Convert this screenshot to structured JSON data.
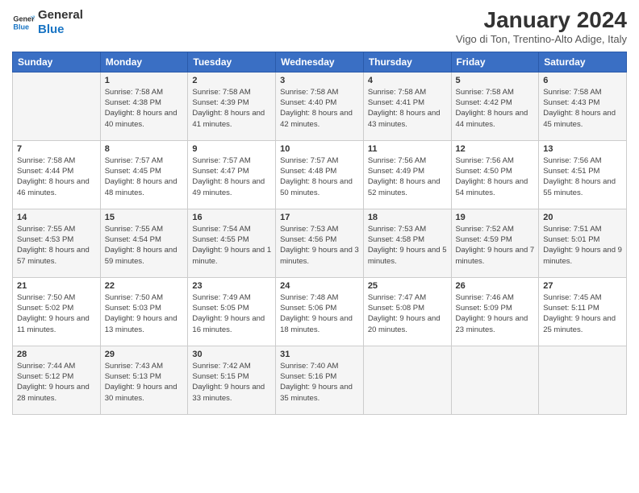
{
  "header": {
    "logo_line1": "General",
    "logo_line2": "Blue",
    "month": "January 2024",
    "location": "Vigo di Ton, Trentino-Alto Adige, Italy"
  },
  "days_of_week": [
    "Sunday",
    "Monday",
    "Tuesday",
    "Wednesday",
    "Thursday",
    "Friday",
    "Saturday"
  ],
  "weeks": [
    [
      {
        "day": "",
        "sunrise": "",
        "sunset": "",
        "daylight": ""
      },
      {
        "day": "1",
        "sunrise": "7:58 AM",
        "sunset": "4:38 PM",
        "daylight": "8 hours and 40 minutes."
      },
      {
        "day": "2",
        "sunrise": "7:58 AM",
        "sunset": "4:39 PM",
        "daylight": "8 hours and 41 minutes."
      },
      {
        "day": "3",
        "sunrise": "7:58 AM",
        "sunset": "4:40 PM",
        "daylight": "8 hours and 42 minutes."
      },
      {
        "day": "4",
        "sunrise": "7:58 AM",
        "sunset": "4:41 PM",
        "daylight": "8 hours and 43 minutes."
      },
      {
        "day": "5",
        "sunrise": "7:58 AM",
        "sunset": "4:42 PM",
        "daylight": "8 hours and 44 minutes."
      },
      {
        "day": "6",
        "sunrise": "7:58 AM",
        "sunset": "4:43 PM",
        "daylight": "8 hours and 45 minutes."
      }
    ],
    [
      {
        "day": "7",
        "sunrise": "7:58 AM",
        "sunset": "4:44 PM",
        "daylight": "8 hours and 46 minutes."
      },
      {
        "day": "8",
        "sunrise": "7:57 AM",
        "sunset": "4:45 PM",
        "daylight": "8 hours and 48 minutes."
      },
      {
        "day": "9",
        "sunrise": "7:57 AM",
        "sunset": "4:47 PM",
        "daylight": "8 hours and 49 minutes."
      },
      {
        "day": "10",
        "sunrise": "7:57 AM",
        "sunset": "4:48 PM",
        "daylight": "8 hours and 50 minutes."
      },
      {
        "day": "11",
        "sunrise": "7:56 AM",
        "sunset": "4:49 PM",
        "daylight": "8 hours and 52 minutes."
      },
      {
        "day": "12",
        "sunrise": "7:56 AM",
        "sunset": "4:50 PM",
        "daylight": "8 hours and 54 minutes."
      },
      {
        "day": "13",
        "sunrise": "7:56 AM",
        "sunset": "4:51 PM",
        "daylight": "8 hours and 55 minutes."
      }
    ],
    [
      {
        "day": "14",
        "sunrise": "7:55 AM",
        "sunset": "4:53 PM",
        "daylight": "8 hours and 57 minutes."
      },
      {
        "day": "15",
        "sunrise": "7:55 AM",
        "sunset": "4:54 PM",
        "daylight": "8 hours and 59 minutes."
      },
      {
        "day": "16",
        "sunrise": "7:54 AM",
        "sunset": "4:55 PM",
        "daylight": "9 hours and 1 minute."
      },
      {
        "day": "17",
        "sunrise": "7:53 AM",
        "sunset": "4:56 PM",
        "daylight": "9 hours and 3 minutes."
      },
      {
        "day": "18",
        "sunrise": "7:53 AM",
        "sunset": "4:58 PM",
        "daylight": "9 hours and 5 minutes."
      },
      {
        "day": "19",
        "sunrise": "7:52 AM",
        "sunset": "4:59 PM",
        "daylight": "9 hours and 7 minutes."
      },
      {
        "day": "20",
        "sunrise": "7:51 AM",
        "sunset": "5:01 PM",
        "daylight": "9 hours and 9 minutes."
      }
    ],
    [
      {
        "day": "21",
        "sunrise": "7:50 AM",
        "sunset": "5:02 PM",
        "daylight": "9 hours and 11 minutes."
      },
      {
        "day": "22",
        "sunrise": "7:50 AM",
        "sunset": "5:03 PM",
        "daylight": "9 hours and 13 minutes."
      },
      {
        "day": "23",
        "sunrise": "7:49 AM",
        "sunset": "5:05 PM",
        "daylight": "9 hours and 16 minutes."
      },
      {
        "day": "24",
        "sunrise": "7:48 AM",
        "sunset": "5:06 PM",
        "daylight": "9 hours and 18 minutes."
      },
      {
        "day": "25",
        "sunrise": "7:47 AM",
        "sunset": "5:08 PM",
        "daylight": "9 hours and 20 minutes."
      },
      {
        "day": "26",
        "sunrise": "7:46 AM",
        "sunset": "5:09 PM",
        "daylight": "9 hours and 23 minutes."
      },
      {
        "day": "27",
        "sunrise": "7:45 AM",
        "sunset": "5:11 PM",
        "daylight": "9 hours and 25 minutes."
      }
    ],
    [
      {
        "day": "28",
        "sunrise": "7:44 AM",
        "sunset": "5:12 PM",
        "daylight": "9 hours and 28 minutes."
      },
      {
        "day": "29",
        "sunrise": "7:43 AM",
        "sunset": "5:13 PM",
        "daylight": "9 hours and 30 minutes."
      },
      {
        "day": "30",
        "sunrise": "7:42 AM",
        "sunset": "5:15 PM",
        "daylight": "9 hours and 33 minutes."
      },
      {
        "day": "31",
        "sunrise": "7:40 AM",
        "sunset": "5:16 PM",
        "daylight": "9 hours and 35 minutes."
      },
      {
        "day": "",
        "sunrise": "",
        "sunset": "",
        "daylight": ""
      },
      {
        "day": "",
        "sunrise": "",
        "sunset": "",
        "daylight": ""
      },
      {
        "day": "",
        "sunrise": "",
        "sunset": "",
        "daylight": ""
      }
    ]
  ]
}
